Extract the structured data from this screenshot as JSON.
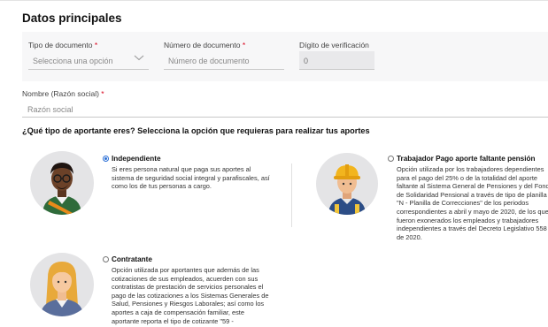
{
  "section_title": "Datos principales",
  "fields": {
    "tipo_documento": {
      "label": "Tipo de documento",
      "required_mark": "*",
      "placeholder": "Selecciona una opción"
    },
    "numero_documento": {
      "label": "Número de documento",
      "required_mark": "*",
      "placeholder": "Número de documento"
    },
    "digito_verificacion": {
      "label": "Dígito de verificación",
      "value": "0"
    },
    "nombre": {
      "label": "Nombre (Razón social)",
      "required_mark": "*",
      "placeholder": "Razón social"
    }
  },
  "question": "¿Qué tipo de aportante eres? Selecciona la opción que requieras para realizar tus aportes",
  "options": [
    {
      "title": "Independiente",
      "selected": true,
      "description": "Si eres persona natural que paga sus aportes al\nsistema de seguridad social integral y parafiscales, así\ncomo los de tus personas a cargo.",
      "icon": "independent-worker-avatar-icon"
    },
    {
      "title": "Trabajador Pago aporte faltante pensión",
      "selected": false,
      "description": "Opción utilizada por los trabajadores dependientes\npara el pago del 25% o de la totalidad del aporte\nfaltante al Sistema General de Pensiones y del Fondo\nde Solidaridad Pensional a través de tipo de planilla\n\"N - Planilla de Correcciones\" de los periodos\ncorrespondientes a abril y mayo de 2020, de los que\nfueron exonerados los empleados y trabajadores\nindependientes a través del Decreto Legislativo 558\nde 2020.",
      "icon": "construction-worker-avatar-icon"
    },
    {
      "title": "Contratante",
      "selected": false,
      "description": "Opción utilizada por aportantes que además de las\ncotizaciones de sus empleados, acuerden con sus\ncontratistas de prestación de servicios personales el\npago de las cotizaciones a los Sistemas Generales de\nSalud, Pensiones y Riesgos Laborales; así como los\naportes a caja de compensación familiar, este\naportante reporta el tipo de cotizante \"59 -",
      "icon": "business-woman-avatar-icon"
    }
  ],
  "colors": {
    "accent": "#2b6fd6",
    "required": "#d9001b",
    "form_bg": "#f7f7f8"
  }
}
